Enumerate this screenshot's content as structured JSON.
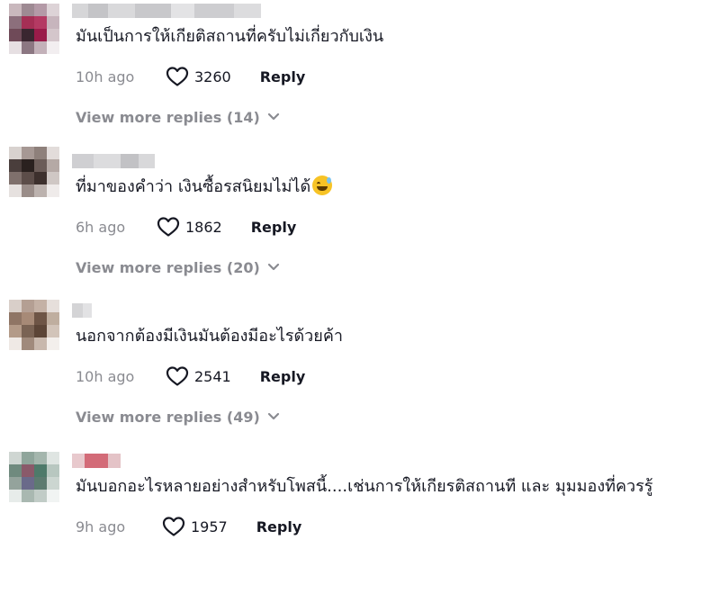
{
  "comments": [
    {
      "text": "มันเป็นการให้เกียติสถานที่ครับไม่เกี่ยวกับเงิน",
      "time": "10h ago",
      "likes": "3260",
      "reply": "Reply",
      "view_more": "View more replies (14)",
      "emoji": ""
    },
    {
      "text": "ที่มาของคำว่า เงินซื้อรสนิยมไม่ได้",
      "time": "6h ago",
      "likes": "1862",
      "reply": "Reply",
      "view_more": "View more replies (20)",
      "emoji": "sweat-smile-emoji"
    },
    {
      "text": "นอกจากต้องมีเงินมันต้องมีอะไรด้วยค้า",
      "time": "10h ago",
      "likes": "2541",
      "reply": "Reply",
      "view_more": "View more replies (49)",
      "emoji": ""
    },
    {
      "text": "มันบอกอะไรหลายอย่างสำหรับโพสนี้....เช่นการให้เกียรติสถานที และ มุมมองที่ควรรู้",
      "time": "9h ago",
      "likes": "1957",
      "reply": "Reply",
      "view_more": "",
      "emoji": ""
    }
  ],
  "icons": {
    "like": "heart-outline-icon",
    "expand": "chevron-down-icon"
  },
  "colors": {
    "muted": "#8a8b91",
    "text": "#161823",
    "background": "#ffffff"
  }
}
